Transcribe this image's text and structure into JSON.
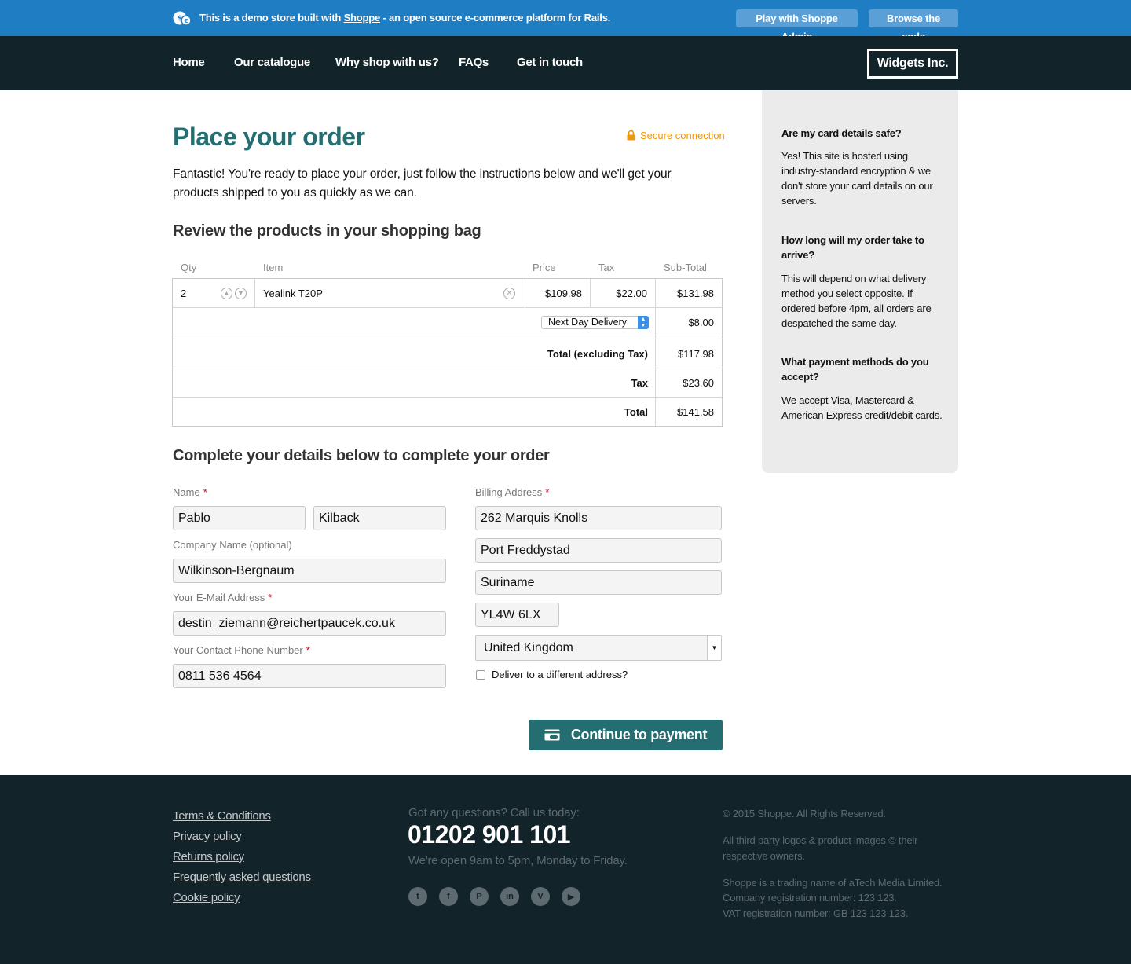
{
  "demo_bar": {
    "text_before": "This is a demo store built with",
    "link": "Shoppe",
    "text_after": "- an open source e-commerce platform for Rails.",
    "admin_button": "Play with Shoppe Admin",
    "code_button": "Browse the code"
  },
  "nav": {
    "items": [
      "Home",
      "Our catalogue",
      "Why shop with us?",
      "FAQs",
      "Get in touch"
    ],
    "brand": "Widgets Inc."
  },
  "page": {
    "title": "Place your order",
    "secure": "Secure connection",
    "intro": "Fantastic! You're ready to place your order, just follow the instructions below and we'll get your products shipped to you as quickly as we can.",
    "review_heading": "Review the products in your shopping bag",
    "details_heading": "Complete your details below to complete your order"
  },
  "bag": {
    "headers": {
      "qty": "Qty",
      "item": "Item",
      "price": "Price",
      "tax": "Tax",
      "subtotal": "Sub-Total"
    },
    "item": {
      "qty": "2",
      "name": "Yealink T20P",
      "price": "$109.98",
      "tax": "$22.00",
      "subtotal": "$131.98"
    },
    "delivery": {
      "method": "Next Day Delivery",
      "price": "$8.00"
    },
    "total_ex_label": "Total (excluding Tax)",
    "total_ex": "$117.98",
    "tax_label": "Tax",
    "tax": "$23.60",
    "total_label": "Total",
    "total": "$141.58"
  },
  "form": {
    "name_label": "Name",
    "first_name": "Pablo",
    "last_name": "Kilback",
    "company_label": "Company Name (optional)",
    "company": "Wilkinson-Bergnaum",
    "email_label": "Your E-Mail Address",
    "email": "destin_ziemann@reichertpaucek.co.uk",
    "phone_label": "Your Contact Phone Number",
    "phone": "0811 536 4564",
    "billing_label": "Billing Address",
    "address1": "262 Marquis Knolls",
    "address2": "Port Freddystad",
    "address3": "Suriname",
    "postcode": "YL4W 6LX",
    "country": "United Kingdom",
    "deliver_different": "Deliver to a different address?",
    "required_mark": "*",
    "submit": "Continue to payment"
  },
  "sidebar": {
    "q1": "Are my card details safe?",
    "a1": "Yes! This site is hosted using industry-standard encryption & we don't store your card details on our servers.",
    "q2": "How long will my order take to arrive?",
    "a2": "This will depend on what delivery method you select opposite. If ordered before 4pm, all orders are despatched the same day.",
    "q3": "What payment methods do you accept?",
    "a3": "We accept Visa, Mastercard & American Express credit/debit cards."
  },
  "footer": {
    "links": [
      "Terms & Conditions",
      "Privacy policy",
      "Returns policy",
      "Frequently asked questions",
      "Cookie policy"
    ],
    "question": "Got any questions? Call us today:",
    "phone": "01202 901 101",
    "hours": "We're open 9am to 5pm, Monday to Friday.",
    "social_icons": [
      "twitter-icon",
      "facebook-icon",
      "pinterest-icon",
      "linkedin-icon",
      "vimeo-icon",
      "youtube-icon"
    ],
    "copyright": "© 2015 Shoppe. All Rights Reserved.",
    "logos": "All third party logos & product images © their respective owners.",
    "company_line1": "Shoppe is a trading name of aTech Media Limited.",
    "company_line2": "Company registration number: 123 123.",
    "company_line3": "VAT registration number: GB 123 123 123."
  },
  "colors": {
    "demo_bar": "#1f7dc3",
    "nav": "#13232a",
    "accent": "#246e72",
    "secure": "#f0960a",
    "required": "#d0021b"
  }
}
